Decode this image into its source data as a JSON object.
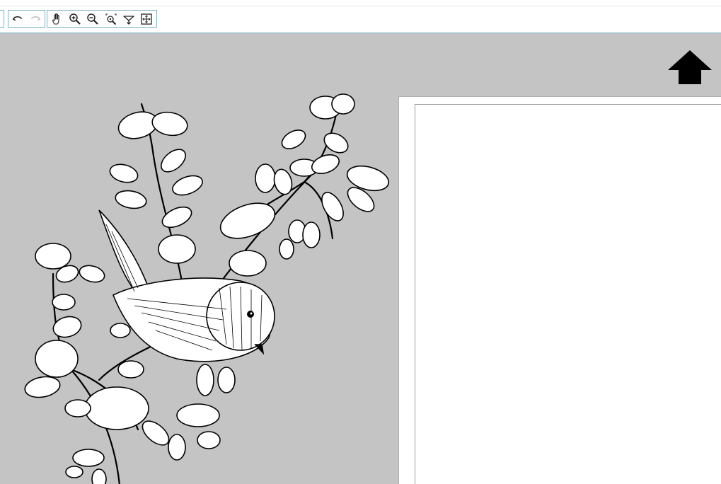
{
  "toolbar": {
    "history_group": [
      "undo-icon",
      "redo-icon"
    ],
    "view_group": [
      "pan-hand-icon",
      "zoom-in-icon",
      "zoom-out-icon",
      "zoom-fit-icon",
      "flip-icon",
      "center-icon"
    ],
    "redo_enabled": false
  },
  "canvas": {
    "background_color": "#c4c4c4",
    "artwork": "bird-on-snowy-branch-sketch",
    "mat_color": "#ffffff"
  },
  "navigation": {
    "arrow_icon": "up-arrow-icon"
  }
}
